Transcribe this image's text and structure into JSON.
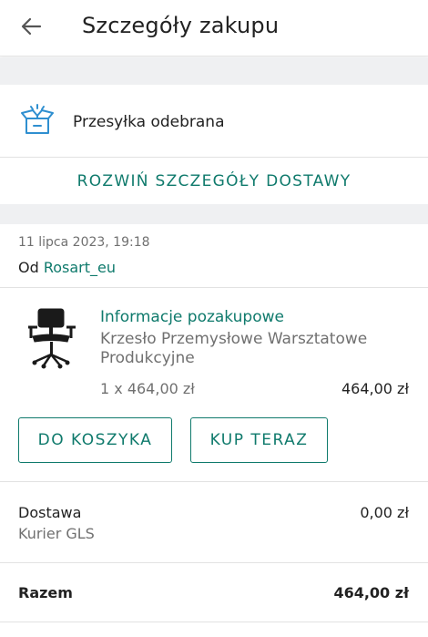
{
  "header": {
    "back_icon": "arrow-left-icon",
    "title": "Szczegóły zakupu"
  },
  "shipment": {
    "icon": "open-box-icon",
    "status": "Przesyłka odebrana",
    "expand_label": "ROZWIŃ SZCZEGÓŁY DOSTAWY"
  },
  "order": {
    "date": "11 lipca 2023, 19:18",
    "from_prefix": "Od",
    "seller": "Rosart_eu"
  },
  "item": {
    "thumbnail_icon": "office-chair-image",
    "info_link": "Informacje pozakupowe",
    "name": "Krzesło Przemysłowe Warsztatowe Produkcyjne",
    "quantity_price": "1 x 464,00 zł",
    "line_total": "464,00 zł",
    "add_to_cart_label": "DO KOSZYKA",
    "buy_now_label": "KUP TERAZ"
  },
  "delivery": {
    "label": "Dostawa",
    "method": "Kurier GLS",
    "price": "0,00 zł"
  },
  "summary": {
    "total_label": "Razem",
    "total_value": "464,00 zł"
  },
  "colors": {
    "accent": "#0f7a6c",
    "icon_blue": "#2f8fd0",
    "section_gap": "#eff0f2",
    "muted_text": "#707070"
  }
}
